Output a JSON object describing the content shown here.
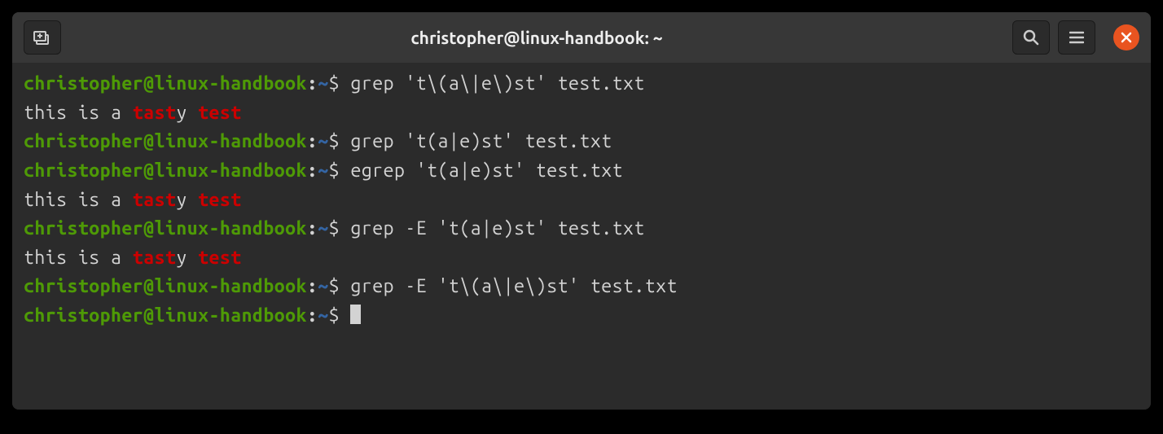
{
  "window": {
    "title": "christopher@linux-handbook: ~"
  },
  "prompt": {
    "user_host": "christopher@linux-handbook",
    "colon": ":",
    "path": "~",
    "dollar": "$"
  },
  "lines": [
    {
      "cmd": "grep 't\\(a\\|e\\)st' test.txt"
    },
    {
      "prefix": "this is a ",
      "match1": "tast",
      "mid": "y ",
      "match2": "test"
    },
    {
      "cmd": "grep 't(a|e)st' test.txt"
    },
    {
      "cmd": "egrep 't(a|e)st' test.txt"
    },
    {
      "prefix": "this is a ",
      "match1": "tast",
      "mid": "y ",
      "match2": "test"
    },
    {
      "cmd": "grep -E 't(a|e)st' test.txt"
    },
    {
      "prefix": "this is a ",
      "match1": "tast",
      "mid": "y ",
      "match2": "test"
    },
    {
      "cmd": "grep -E 't\\(a\\|e\\)st' test.txt"
    },
    {
      "cmd": ""
    }
  ],
  "icons": {
    "newtab": "new-tab-icon",
    "search": "search-icon",
    "menu": "hamburger-icon",
    "close": "close-icon"
  }
}
